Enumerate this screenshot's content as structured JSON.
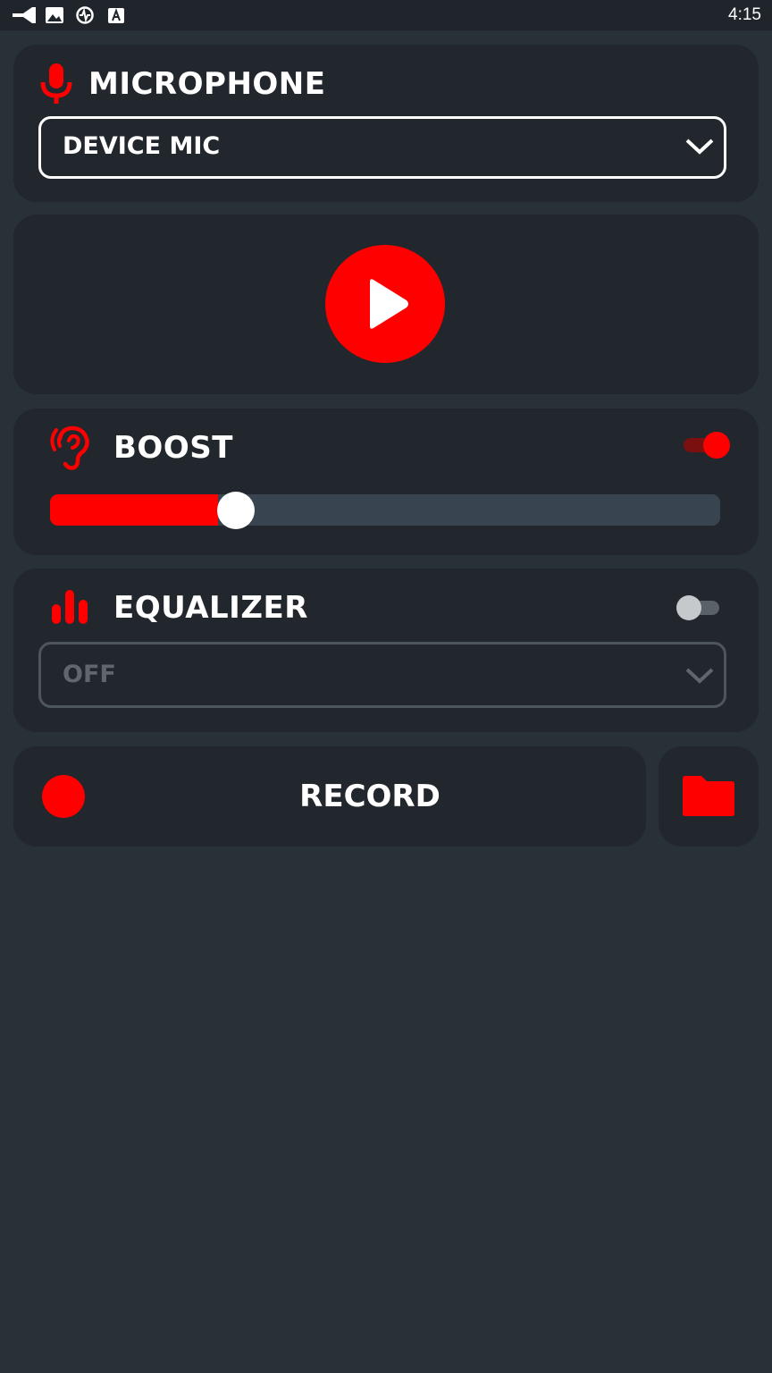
{
  "status_bar": {
    "time": "4:15",
    "icons": [
      "notification-icon",
      "image-icon",
      "sync-icon",
      "keyboard-a-icon"
    ]
  },
  "microphone": {
    "title": "MICROPHONE",
    "icon": "microphone-icon",
    "selected": "DEVICE MIC"
  },
  "player": {
    "icon": "play-icon"
  },
  "boost": {
    "title": "BOOST",
    "icon": "ear-icon",
    "enabled": true,
    "level_fraction": 0.25
  },
  "equalizer": {
    "title": "EQUALIZER",
    "icon": "equalizer-bars-icon",
    "enabled": false,
    "selected": "OFF"
  },
  "record": {
    "label": "RECORD",
    "icon": "record-dot-icon",
    "folder_icon": "folder-icon"
  },
  "colors": {
    "accent": "#ff0000",
    "background": "#283038",
    "card": "#22272d",
    "track": "#384550",
    "disabled_text": "#5f666c"
  }
}
